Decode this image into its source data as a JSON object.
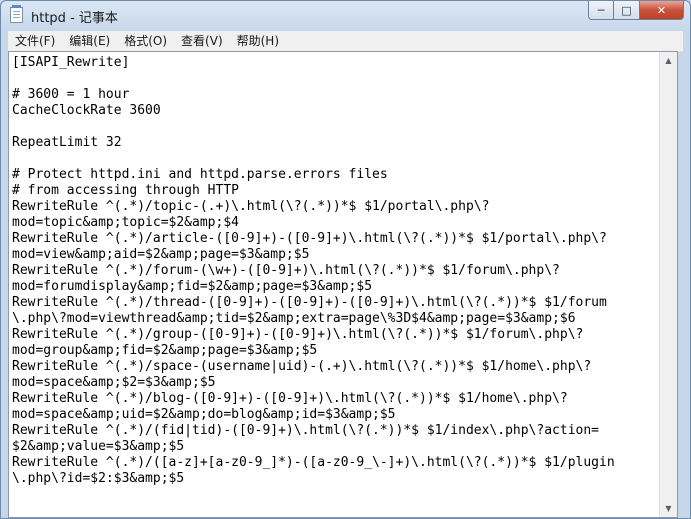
{
  "window": {
    "title": "httpd - 记事本",
    "minimize_label": "─",
    "maximize_label": "□",
    "close_label": "✕"
  },
  "menu": {
    "file": "文件(F)",
    "edit": "编辑(E)",
    "format": "格式(O)",
    "view": "查看(V)",
    "help": "帮助(H)"
  },
  "editor": {
    "content": "[ISAPI_Rewrite]\n\n# 3600 = 1 hour\nCacheClockRate 3600\n\nRepeatLimit 32\n\n# Protect httpd.ini and httpd.parse.errors files\n# from accessing through HTTP\nRewriteRule ^(.*)/topic-(.+)\\.html(\\?(.*))*$ $1/portal\\.php\\?\nmod=topic&amp;topic=$2&amp;$4\nRewriteRule ^(.*)/article-([0-9]+)-([0-9]+)\\.html(\\?(.*))*$ $1/portal\\.php\\?\nmod=view&amp;aid=$2&amp;page=$3&amp;$5\nRewriteRule ^(.*)/forum-(\\w+)-([0-9]+)\\.html(\\?(.*))*$ $1/forum\\.php\\?\nmod=forumdisplay&amp;fid=$2&amp;page=$3&amp;$5\nRewriteRule ^(.*)/thread-([0-9]+)-([0-9]+)-([0-9]+)\\.html(\\?(.*))*$ $1/forum\n\\.php\\?mod=viewthread&amp;tid=$2&amp;extra=page\\%3D$4&amp;page=$3&amp;$6\nRewriteRule ^(.*)/group-([0-9]+)-([0-9]+)\\.html(\\?(.*))*$ $1/forum\\.php\\?\nmod=group&amp;fid=$2&amp;page=$3&amp;$5\nRewriteRule ^(.*)/space-(username|uid)-(.+)\\.html(\\?(.*))*$ $1/home\\.php\\?\nmod=space&amp;$2=$3&amp;$5\nRewriteRule ^(.*)/blog-([0-9]+)-([0-9]+)\\.html(\\?(.*))*$ $1/home\\.php\\?\nmod=space&amp;uid=$2&amp;do=blog&amp;id=$3&amp;$5\nRewriteRule ^(.*)/(fid|tid)-([0-9]+)\\.html(\\?(.*))*$ $1/index\\.php\\?action=\n$2&amp;value=$3&amp;$5\nRewriteRule ^(.*)/([a-z]+[a-z0-9_]*)-([a-z0-9_\\-]+)\\.html(\\?(.*))*$ $1/plugin\n\\.php\\?id=$2:$3&amp;$5"
  }
}
